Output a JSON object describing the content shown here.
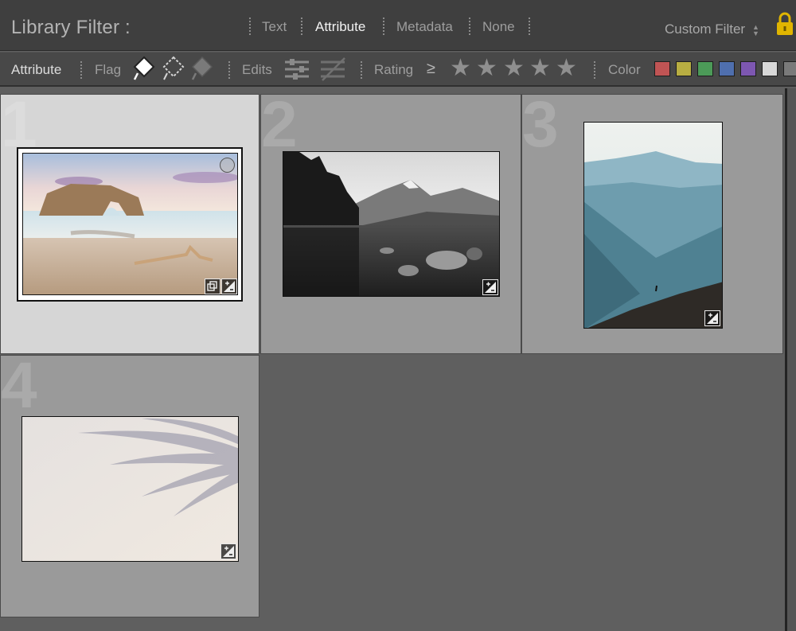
{
  "filter_bar": {
    "title": "Library Filter :",
    "tabs": [
      {
        "label": "Text",
        "active": false
      },
      {
        "label": "Attribute",
        "active": true
      },
      {
        "label": "Metadata",
        "active": false
      },
      {
        "label": "None",
        "active": false
      }
    ],
    "custom_filter_label": "Custom Filter",
    "lock_icon": "padlock-icon"
  },
  "attribute_bar": {
    "attribute_label": "Attribute",
    "flag_label": "Flag",
    "edits_label": "Edits",
    "rating_label": "Rating",
    "rating_operator": "≥",
    "stars": [
      "★",
      "★",
      "★",
      "★",
      "★"
    ],
    "color_label": "Color",
    "colors": [
      "#c05454",
      "#b8ae42",
      "#4c9a58",
      "#4f6fae",
      "#7d57b1",
      "#d8d8d8",
      "#7a7a7a"
    ]
  },
  "grid": {
    "cells": [
      {
        "number": "1",
        "selected": true
      },
      {
        "number": "2",
        "selected": false
      },
      {
        "number": "3",
        "selected": false
      },
      {
        "number": "4",
        "selected": false
      }
    ]
  },
  "colors": {
    "cell_selected": "#d6d6d6",
    "cell_normal": "#9a9a9a",
    "grid_background": "#5f5f5f"
  }
}
